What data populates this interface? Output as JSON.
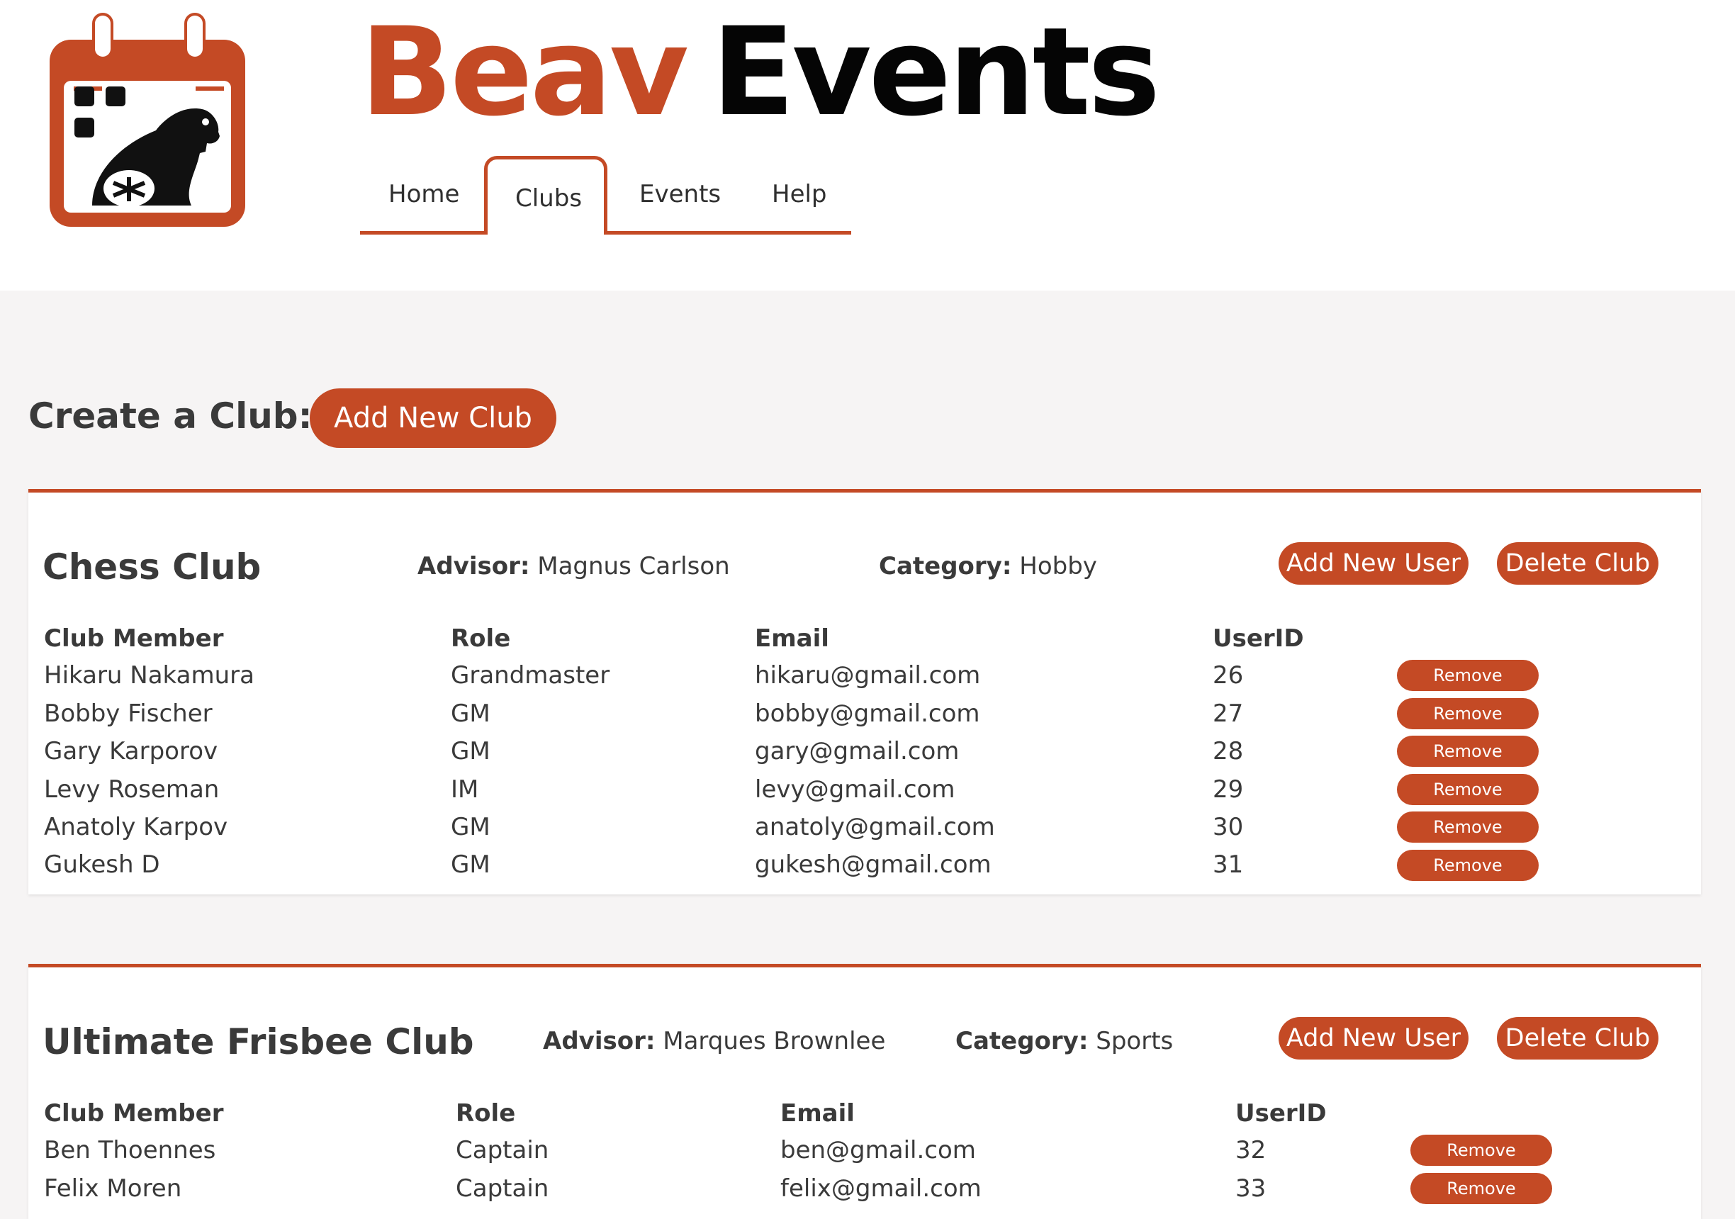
{
  "brand": {
    "part1": "Beav",
    "part2": "Events",
    "accent_color": "#c44a25"
  },
  "logo": {
    "icon": "calendar-beaver-icon"
  },
  "nav": {
    "tabs": [
      {
        "label": "Home",
        "active": false
      },
      {
        "label": "Clubs",
        "active": true
      },
      {
        "label": "Events",
        "active": false
      },
      {
        "label": "Help",
        "active": false
      }
    ]
  },
  "create": {
    "label": "Create a Club:",
    "button": "Add New Club"
  },
  "card_labels": {
    "advisor": "Advisor:",
    "category": "Category:",
    "add_user": "Add New User",
    "delete_club": "Delete Club",
    "remove": "Remove",
    "columns": [
      "Club Member",
      "Role",
      "Email",
      "UserID"
    ]
  },
  "clubs": [
    {
      "name": "Chess Club",
      "advisor": "Magnus Carlson",
      "category": "Hobby",
      "members": [
        {
          "name": "Hikaru Nakamura",
          "role": "Grandmaster",
          "email": "hikaru@gmail.com",
          "id": "26"
        },
        {
          "name": "Bobby Fischer",
          "role": "GM",
          "email": "bobby@gmail.com",
          "id": "27"
        },
        {
          "name": "Gary Karporov",
          "role": "GM",
          "email": "gary@gmail.com",
          "id": "28"
        },
        {
          "name": "Levy Roseman",
          "role": "IM",
          "email": "levy@gmail.com",
          "id": "29"
        },
        {
          "name": "Anatoly Karpov",
          "role": "GM",
          "email": "anatoly@gmail.com",
          "id": "30"
        },
        {
          "name": "Gukesh D",
          "role": "GM",
          "email": "gukesh@gmail.com",
          "id": "31"
        }
      ]
    },
    {
      "name": "Ultimate Frisbee Club",
      "advisor": "Marques Brownlee",
      "category": "Sports",
      "members": [
        {
          "name": "Ben Thoennes",
          "role": "Captain",
          "email": "ben@gmail.com",
          "id": "32"
        },
        {
          "name": "Felix Moren",
          "role": "Captain",
          "email": "felix@gmail.com",
          "id": "33"
        }
      ]
    }
  ]
}
